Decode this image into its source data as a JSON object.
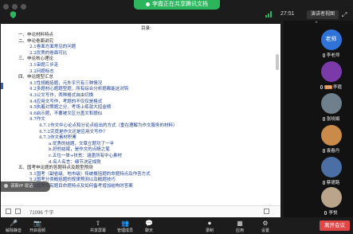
{
  "top": {
    "share_status": "李霞正在共享腾讯文档",
    "timer": "27:51",
    "gallery_label": "演讲者视图"
  },
  "doc": {
    "title": "目录:",
    "lines": [
      {
        "text": "一、申论材料特点",
        "blue": false
      },
      {
        "text": "二、申论卷面讲究",
        "blue": false
      },
      {
        "text": "2.1卷面方面常见的问题",
        "blue": true
      },
      {
        "text": "2.2优秀的卷面可比",
        "blue": true
      },
      {
        "text": "三、申论核心理论",
        "blue": false
      },
      {
        "text": "3.1审题三步走",
        "blue": true
      },
      {
        "text": "3.2问题标志",
        "blue": true
      },
      {
        "text": "四、申论题型汇总",
        "blue": false
      },
      {
        "text": "4.1性规概括题，元外乎只有三种情况",
        "blue": true
      },
      {
        "text": "4.2多题材心题题型题，所有综合分析题都能这对钩",
        "blue": true
      },
      {
        "text": "4.3公文写作，两种格式自由切换",
        "blue": true
      },
      {
        "text": "4.4应用文写作，考题的不仅仅是格式",
        "blue": true
      },
      {
        "text": "4.5执着对策题之分、考场上练就大招金榜",
        "blue": true
      },
      {
        "text": "4.6启示题，不要被文区分盖文和貌似",
        "blue": true
      },
      {
        "text": "4.7作文",
        "blue": true
      },
      {
        "text": "4.7.1作文中心论点和分论点给出的方式（重在理解为作文服务的材料）",
        "blue": true
      },
      {
        "text": "4.7.2究竟是作文还是应用文写作？",
        "blue": true
      },
      {
        "text": "4.7.3作文素材积累",
        "blue": true
      },
      {
        "text": "a.优秀的结题，文章立题功了一半",
        "blue": true
      },
      {
        "text": "b.好的结尾，是作文的点睛之笔",
        "blue": true
      },
      {
        "text": "c.五位一体+扶贫：涵盖所有中心素材",
        "blue": true
      },
      {
        "text": "d.名人名言：细节决定成败",
        "blue": true
      },
      {
        "text": "五、国考申论题的答题特点及题型预测",
        "blue": false
      },
      {
        "text": "5.1国考（副省级、地市级）传统概括题的命题特点及作答方式",
        "blue": true
      },
      {
        "text": "5.2国考分类概括题的规律预测以及概题技巧",
        "blue": true
      },
      {
        "text": "5.3国考所有题目命题特点及如何备考增加结构时答案",
        "blue": true
      }
    ]
  },
  "status": {
    "word_count": "71096 个字"
  },
  "toast": {
    "text": "该新IP 说话"
  },
  "participants": [
    {
      "name": "李老师",
      "avatar_text": "老师",
      "color": "#2f73d8",
      "host": false
    },
    {
      "name": "李霞",
      "avatar_text": "",
      "color": "#7a3aa8",
      "host": true,
      "tag": "主持"
    },
    {
      "name": "张晓娟",
      "avatar_text": "",
      "color": "#6f7f8c",
      "host": false
    },
    {
      "name": "袁春丹",
      "avatar_text": "",
      "color": "#c98a4a",
      "host": false
    },
    {
      "name": "蔡德路",
      "avatar_text": "",
      "color": "#4b6fa5",
      "host": false
    },
    {
      "name": "李悦",
      "avatar_text": "",
      "color": "#b8a58a",
      "host": false
    }
  ],
  "toolbar": [
    {
      "icon": "mic",
      "label": "解除静音"
    },
    {
      "icon": "video",
      "label": "开启视频"
    },
    {
      "icon": "share",
      "label": "共享屏幕"
    },
    {
      "icon": "members",
      "label": "管理成员"
    },
    {
      "icon": "chat",
      "label": "聊天"
    },
    {
      "icon": "record",
      "label": "录制"
    },
    {
      "icon": "apps",
      "label": "应用"
    },
    {
      "icon": "settings",
      "label": "设置"
    }
  ],
  "leave_label": "离开会议"
}
